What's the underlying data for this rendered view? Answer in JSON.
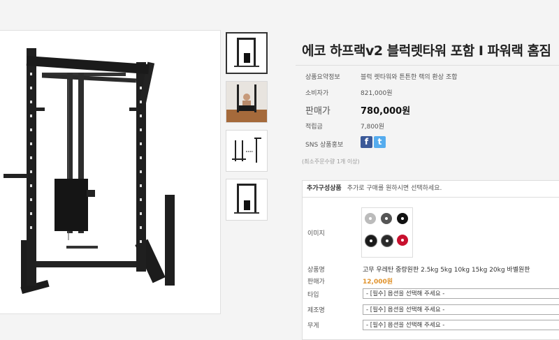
{
  "product": {
    "title": "에코 하프랙v2 블럭렛타워 포함 I 파워랙 홈짐",
    "summary_label": "상품요약정보",
    "summary_value": "블럭 렛타워와 튼튼한 랙의 환상 조합",
    "consumer_price_label": "소비자가",
    "consumer_price_value": "821,000원",
    "price_label": "판매가",
    "price_value": "780,000원",
    "points_label": "적립금",
    "points_value": "7,800원",
    "sns_label": "SNS 상품홍보",
    "sns_facebook": "f",
    "sns_twitter": "t",
    "min_qty_note": "(최소주문수량 1개 이상)"
  },
  "addon": {
    "header_title": "추가구성상품",
    "header_desc": "추가로 구매를 원하시면 선택하세요.",
    "image_label": "이미지",
    "name_label": "상품명",
    "name_value": "고무 우레탄 중량원판 2.5kg 5kg 10kg 15kg 20kg 바벨원판",
    "price_label": "판매가",
    "price_value": "12,000원",
    "type_label": "타입",
    "type_select": "- [필수] 옵션을 선택해 주세요 -",
    "maker_label": "제조명",
    "maker_select": "- [필수] 옵션을 선택해 주세요 -",
    "weight_label": "무게",
    "weight_select": "- [필수] 옵션을 선택해 주세요 -"
  },
  "colors": {
    "accent_price": "#e0922b",
    "facebook": "#3b5998",
    "twitter": "#55acee",
    "plate_red": "#c8102e"
  },
  "icons": [
    "facebook-icon",
    "twitter-icon"
  ]
}
